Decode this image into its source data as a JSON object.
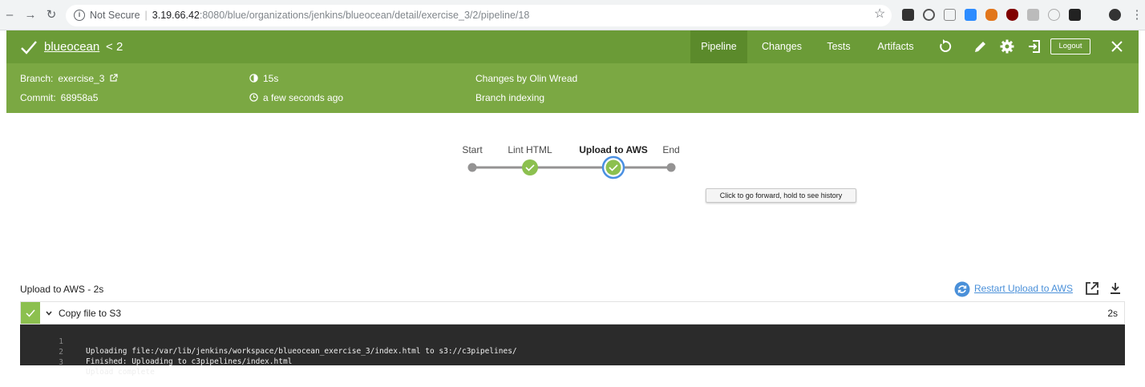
{
  "browser": {
    "security": "Not Secure",
    "url_host": "3.19.66.42",
    "url_rest": ":8080/blue/organizations/jenkins/blueocean/detail/exercise_3/2/pipeline/18"
  },
  "header": {
    "job_name": "blueocean",
    "run_number": "2",
    "tabs": [
      "Pipeline",
      "Changes",
      "Tests",
      "Artifacts"
    ],
    "active_tab": "Pipeline",
    "logout_label": "Logout",
    "accent": "#6b9b37"
  },
  "meta": {
    "branch_label": "Branch:",
    "branch_value": "exercise_3",
    "commit_label": "Commit:",
    "commit_value": "68958a5",
    "duration": "15s",
    "finished": "a few seconds ago",
    "changes": "Changes by Olin Wread",
    "cause": "Branch indexing"
  },
  "pipeline": {
    "stages": [
      {
        "name": "Start",
        "status": "start"
      },
      {
        "name": "Lint HTML",
        "status": "success"
      },
      {
        "name": "Upload to AWS",
        "status": "success",
        "selected": true
      },
      {
        "name": "End",
        "status": "end"
      }
    ],
    "tooltip": "Click to go forward, hold to see history"
  },
  "step_detail": {
    "title": "Upload to AWS - 2s",
    "restart_label": "Restart Upload to AWS",
    "step": {
      "name": "Copy file to S3",
      "duration": "2s"
    },
    "console": [
      {
        "n": "1",
        "text": "Uploading file:/var/lib/jenkins/workspace/blueocean_exercise_3/index.html to s3://c3pipelines/"
      },
      {
        "n": "2",
        "text": "Finished: Uploading to c3pipelines/index.html"
      },
      {
        "n": "3",
        "text": "Upload complete"
      }
    ]
  }
}
